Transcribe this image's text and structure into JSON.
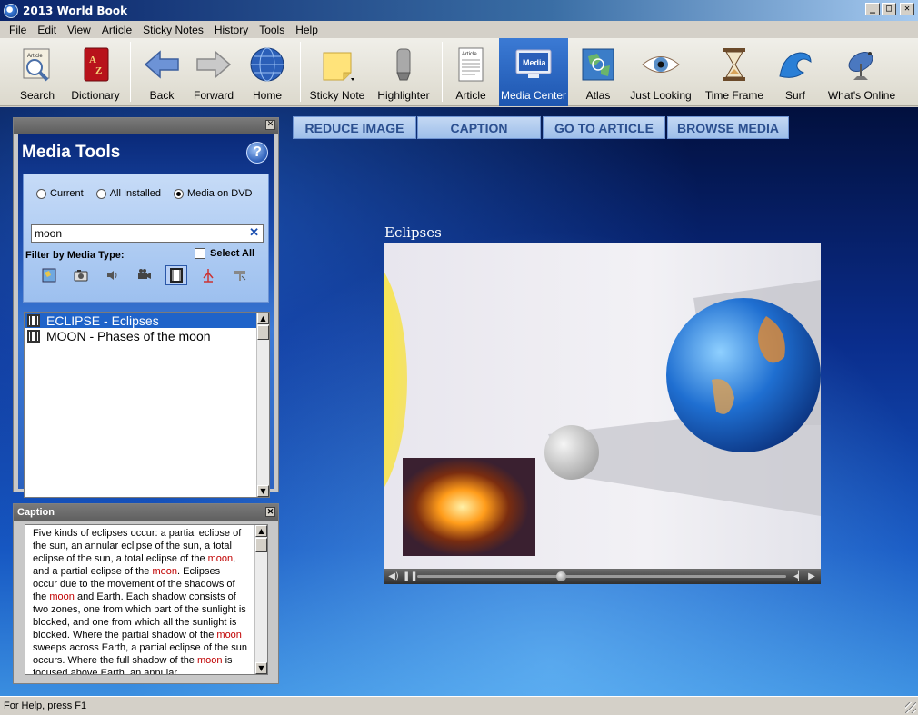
{
  "window": {
    "title": "2013 World Book"
  },
  "menu": [
    "File",
    "Edit",
    "View",
    "Article",
    "Sticky Notes",
    "History",
    "Tools",
    "Help"
  ],
  "toolbar": {
    "search": "Search",
    "dictionary": "Dictionary",
    "back": "Back",
    "forward": "Forward",
    "home": "Home",
    "sticky_note": "Sticky Note",
    "highlighter": "Highlighter",
    "article": "Article",
    "media_center": "Media Center",
    "atlas": "Atlas",
    "just_looking": "Just Looking",
    "time_frame": "Time Frame",
    "surf": "Surf",
    "whats_online": "What's Online",
    "active": "media_center",
    "icon_text": {
      "article": "Article",
      "media": "Media"
    }
  },
  "media_tools": {
    "title": "Media Tools",
    "help_glyph": "?",
    "scope_options": [
      "Current",
      "All Installed",
      "Media on DVD"
    ],
    "scope_selected": "Media on DVD",
    "search_value": "moon",
    "clear_glyph": "✕",
    "filter_label": "Filter by Media Type:",
    "select_all_label": "Select All",
    "select_all_checked": false,
    "media_type_icons": [
      "map-icon",
      "photo-icon",
      "audio-icon",
      "video-camera-icon",
      "animation-film-icon",
      "diagram-icon",
      "interactive-icon"
    ],
    "selected_media_type": "animation-film-icon",
    "results": [
      {
        "label": "ECLIPSE - Eclipses",
        "selected": true
      },
      {
        "label": "MOON - Phases of the moon",
        "selected": false
      }
    ]
  },
  "caption_panel": {
    "title": "Caption",
    "text_parts": [
      "Five kinds of eclipses occur: a partial eclipse of the sun, an annular eclipse of the sun, a total eclipse of the sun, a total eclipse of the ",
      "moon",
      ", and a partial eclipse of the ",
      "moon",
      ". Eclipses occur due to the movement of the shadows of the ",
      "moon",
      " and Earth. Each shadow consists of two zones, one from which part of the sunlight is blocked, and one from which all the sunlight is blocked. Where the partial shadow of the ",
      "moon",
      " sweeps across Earth, a partial eclipse of the sun occurs. Where the full shadow of the ",
      "moon",
      " is focused above Earth, an annular"
    ]
  },
  "media_buttons": {
    "reduce_image": "REDUCE IMAGE",
    "caption": "CAPTION",
    "go_to_article": "GO TO ARTICLE",
    "browse_media": "BROWSE MEDIA"
  },
  "video": {
    "title": "Eclipses",
    "progress": 0.39
  },
  "status": {
    "text": "For Help, press F1"
  },
  "colors": {
    "accent": "#1f63c9",
    "highlight_word": "#c00000"
  }
}
